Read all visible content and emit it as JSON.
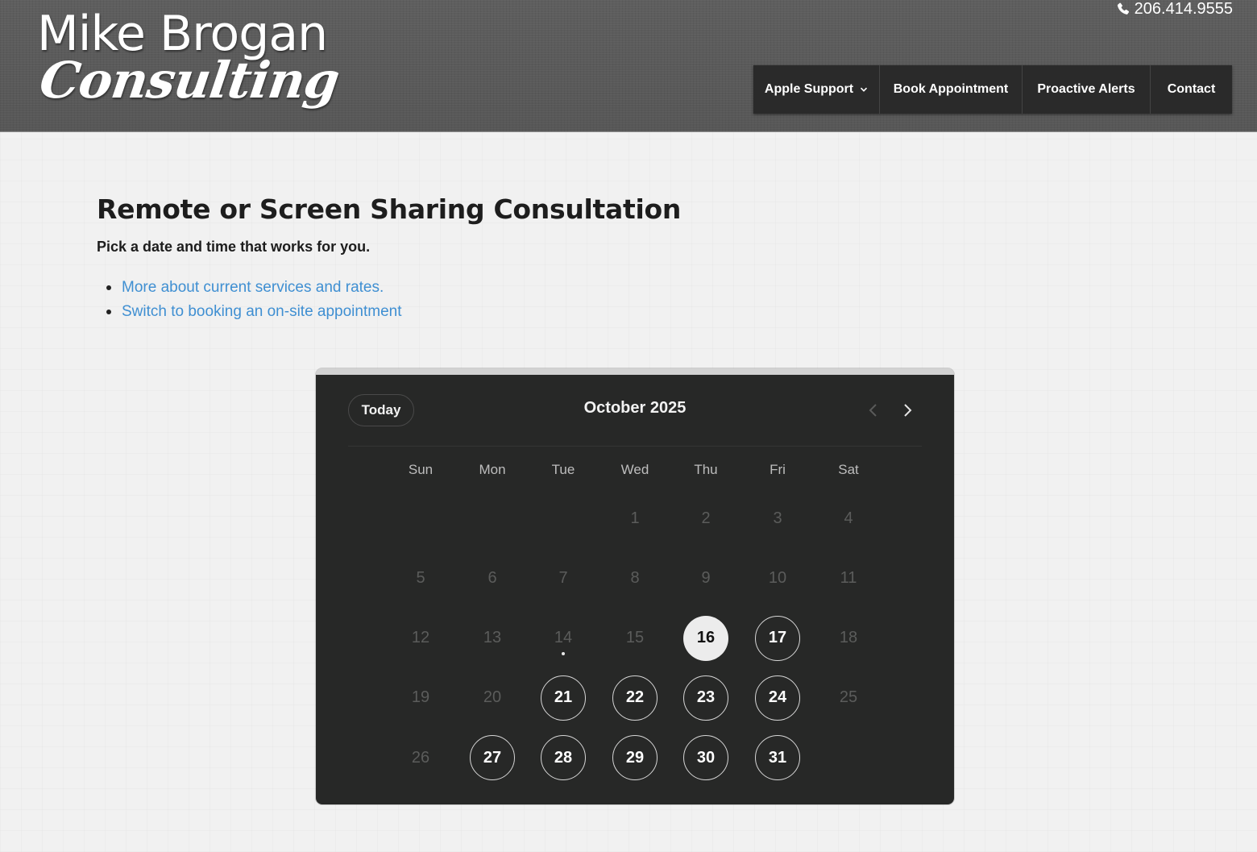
{
  "header": {
    "logo_line1": "Mike Brogan",
    "logo_line2": "Consulting",
    "phone": "206.414.9555",
    "nav": [
      {
        "label": "Apple Support",
        "has_dropdown": true
      },
      {
        "label": "Book Appointment",
        "has_dropdown": false
      },
      {
        "label": "Proactive Alerts",
        "has_dropdown": false
      },
      {
        "label": "Contact",
        "has_dropdown": false
      }
    ]
  },
  "main": {
    "title": "Remote or Screen Sharing Consultation",
    "subtitle": "Pick a date and time that works for you.",
    "links": [
      "More about current services and rates.",
      "Switch to booking an on-site appointment"
    ]
  },
  "calendar": {
    "today_label": "Today",
    "month_label": "October 2025",
    "weekdays": [
      "Sun",
      "Mon",
      "Tue",
      "Wed",
      "Thu",
      "Fri",
      "Sat"
    ],
    "first_weekday_index": 3,
    "days_in_month": 31,
    "today": 14,
    "selected": 16,
    "available": [
      17,
      21,
      22,
      23,
      24,
      27,
      28,
      29,
      30,
      31
    ]
  },
  "colors": {
    "link": "#3f8fd2",
    "calendar_bg": "#272827",
    "nav_bg": "#2a2a2a"
  }
}
